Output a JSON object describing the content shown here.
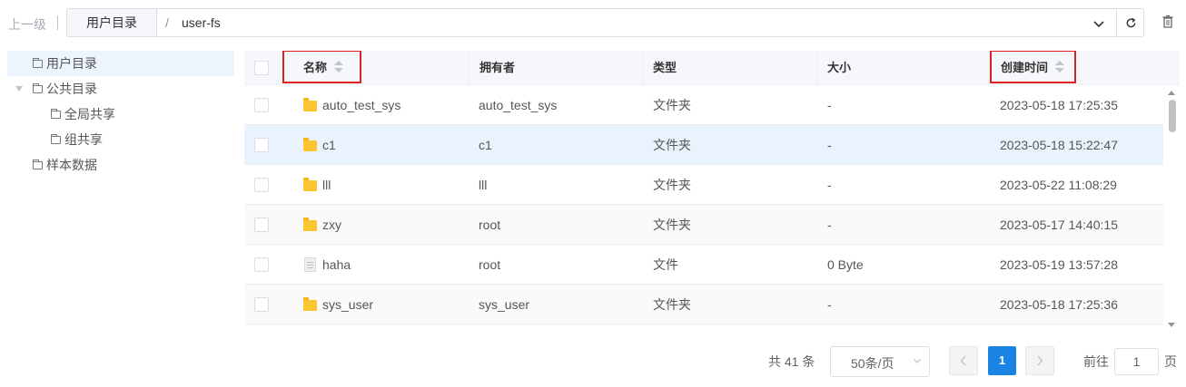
{
  "topbar": {
    "up_level": "上一级",
    "root_segment": "用户目录",
    "separator": "/",
    "current_path": "user-fs"
  },
  "tree": {
    "nodes": [
      {
        "label": "用户目录",
        "level": 0,
        "active": true,
        "expandable": false
      },
      {
        "label": "公共目录",
        "level": 0,
        "active": false,
        "expandable": true
      },
      {
        "label": "全局共享",
        "level": 1,
        "active": false,
        "expandable": false
      },
      {
        "label": "组共享",
        "level": 1,
        "active": false,
        "expandable": false
      },
      {
        "label": "样本数据",
        "level": 0,
        "active": false,
        "expandable": false
      }
    ]
  },
  "table": {
    "columns": [
      "名称",
      "拥有者",
      "类型",
      "大小",
      "创建时间"
    ],
    "rows": [
      {
        "name": "auto_test_sys",
        "owner": "auto_test_sys",
        "type": "文件夹",
        "size": "-",
        "created": "2023-05-18 17:25:35",
        "kind": "folder"
      },
      {
        "name": "c1",
        "owner": "c1",
        "type": "文件夹",
        "size": "-",
        "created": "2023-05-18 15:22:47",
        "kind": "folder"
      },
      {
        "name": "lll",
        "owner": "lll",
        "type": "文件夹",
        "size": "-",
        "created": "2023-05-22 11:08:29",
        "kind": "folder"
      },
      {
        "name": "zxy",
        "owner": "root",
        "type": "文件夹",
        "size": "-",
        "created": "2023-05-17 14:40:15",
        "kind": "folder"
      },
      {
        "name": "haha",
        "owner": "root",
        "type": "文件",
        "size": "0 Byte",
        "created": "2023-05-19 13:57:28",
        "kind": "file"
      },
      {
        "name": "sys_user",
        "owner": "sys_user",
        "type": "文件夹",
        "size": "-",
        "created": "2023-05-18 17:25:36",
        "kind": "folder"
      }
    ]
  },
  "pagination": {
    "total": "共 41 条",
    "page_size": "50条/页",
    "current_page": "1",
    "goto_label": "前往",
    "goto_value": "1",
    "goto_suffix": "页"
  },
  "colors": {
    "accent": "#1a84e5",
    "highlight_border": "#e02020",
    "folder": "#fdc531",
    "selected_row": "#e8f3fd"
  }
}
